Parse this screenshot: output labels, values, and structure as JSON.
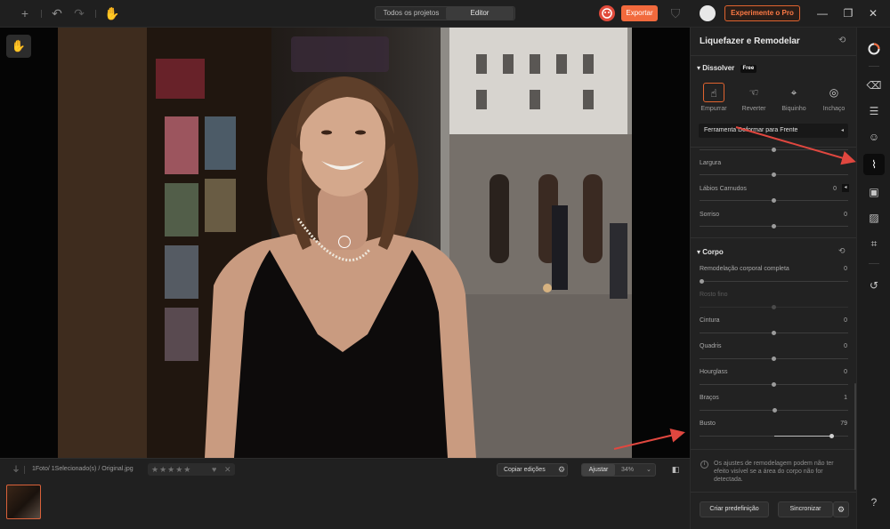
{
  "topbar": {
    "tabs": [
      {
        "label": "Todos os projetos",
        "active": false
      },
      {
        "label": "Editor",
        "active": true
      }
    ],
    "export_label": "Exportar",
    "pro_label": "Experimente o Pro",
    "icons": [
      "plus-icon",
      "undo-icon",
      "redo-icon",
      "hand-icon",
      "shield-icon",
      "minimize-icon",
      "restore-icon",
      "close-icon"
    ]
  },
  "panel": {
    "title": "Liquefazer e Remodelar",
    "dissolver": {
      "title": "Dissolver",
      "badge": "Free",
      "tools": [
        {
          "label": "Empurrar",
          "active": true,
          "icon": "push-hand-icon"
        },
        {
          "label": "Reverter",
          "active": false,
          "icon": "revert-hand-icon"
        },
        {
          "label": "Biquinho",
          "active": false,
          "icon": "pucker-icon"
        },
        {
          "label": "Inchaço",
          "active": false,
          "icon": "bloat-icon"
        }
      ],
      "tool_note": "Ferramenta Deformar para Frente"
    },
    "face_sliders": [
      {
        "label": "Largura",
        "value": "",
        "fraction": 0.5
      },
      {
        "label": "Lábios Carnudos",
        "value": "0",
        "fraction": 0.5
      },
      {
        "label": "Sorriso",
        "value": "0",
        "fraction": 0.5
      }
    ],
    "corpo": {
      "title": "Corpo",
      "sliders": [
        {
          "label": "Remodelação corporal completa",
          "value": "0",
          "fraction": 0.0,
          "disabled": false
        },
        {
          "label": "Rosto fino",
          "value": "",
          "fraction": 0.5,
          "disabled": true
        },
        {
          "label": "Cintura",
          "value": "0",
          "fraction": 0.5,
          "disabled": false
        },
        {
          "label": "Quadris",
          "value": "0",
          "fraction": 0.5,
          "disabled": false
        },
        {
          "label": "Hourglass",
          "value": "0",
          "fraction": 0.5,
          "disabled": false
        },
        {
          "label": "Braços",
          "value": "1",
          "fraction": 0.5,
          "disabled": false
        },
        {
          "label": "Busto",
          "value": "79",
          "fraction": 0.89,
          "disabled": false
        }
      ]
    },
    "info_text": "Os ajustes de remodelagem podem não ter efeito visível se a área do corpo não for detectada.",
    "create_preset_label": "Criar predefinição",
    "sync_label": "Sincronizar"
  },
  "bottombar": {
    "breadcrumb": "1Foto/ 1Selecionado(s) / Original.jpg",
    "rating_stars": "★★★★★",
    "copy_label": "Copiar edições",
    "fit_label": "Ajustar",
    "zoom_value": "34%"
  },
  "rail": {
    "items": [
      {
        "icon": "preset-ring-icon",
        "active": false
      },
      {
        "icon": "eraser-icon",
        "active": false
      },
      {
        "icon": "sliders-icon",
        "active": false
      },
      {
        "icon": "face-retouch-icon",
        "active": false
      },
      {
        "icon": "liquify-icon",
        "active": true
      },
      {
        "icon": "image-icon",
        "active": false
      },
      {
        "icon": "texture-icon",
        "active": false
      },
      {
        "icon": "crop-icon",
        "active": false
      },
      {
        "icon": "history-icon",
        "active": false
      },
      {
        "icon": "help-icon",
        "active": false
      }
    ]
  },
  "colors": {
    "accent": "#f26a3d",
    "pro_text": "#ff7a45",
    "annotation_arrow": "#e0473f"
  }
}
